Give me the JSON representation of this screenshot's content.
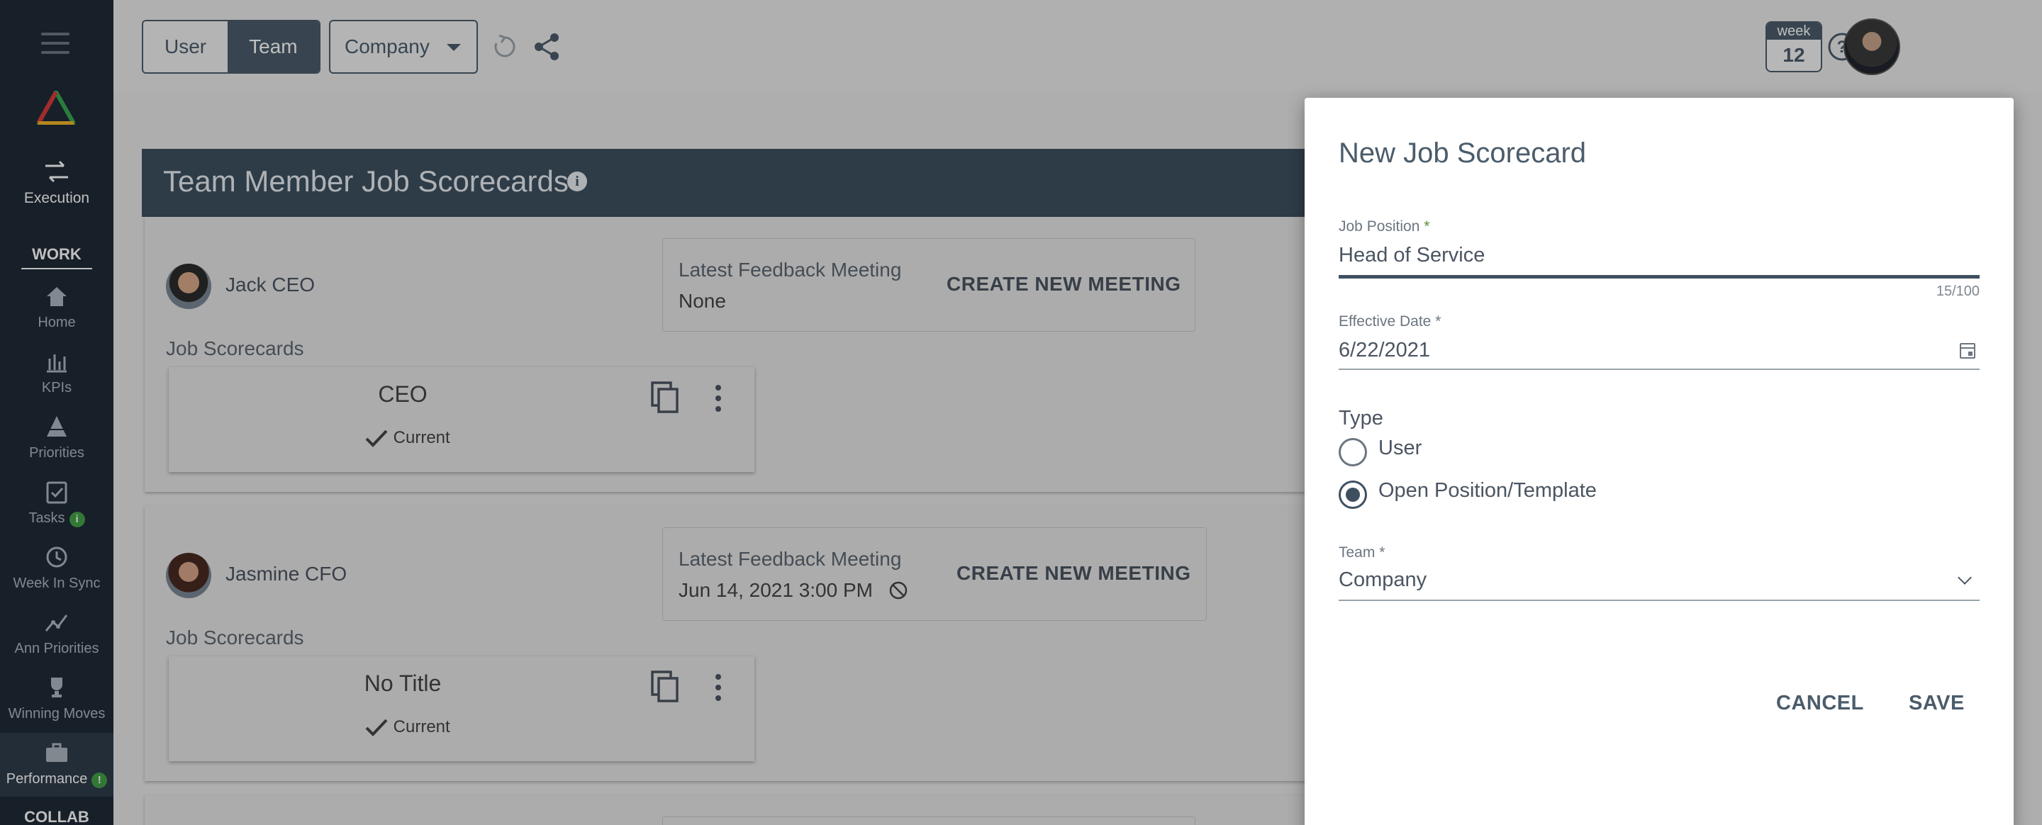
{
  "sidebar": {
    "execution_label": "Execution",
    "work_heading": "WORK",
    "items": [
      {
        "label": "Home",
        "icon": "home-icon"
      },
      {
        "label": "KPIs",
        "icon": "chart-bars-icon"
      },
      {
        "label": "Priorities",
        "icon": "priorities-icon"
      },
      {
        "label": "Tasks",
        "icon": "tasks-icon",
        "badge": "i"
      },
      {
        "label": "Week In Sync",
        "icon": "sync-icon"
      },
      {
        "label": "Ann Priorities",
        "icon": "trend-icon"
      },
      {
        "label": "Winning Moves",
        "icon": "trophy-icon"
      },
      {
        "label": "Performance",
        "icon": "briefcase-icon",
        "badge": "!"
      }
    ],
    "collab_heading": "COLLAB"
  },
  "topbar": {
    "toggle": {
      "user": "User",
      "team": "Team",
      "selected": "Team"
    },
    "team_select": "Company",
    "week_label": "week",
    "week_number": "12"
  },
  "panel": {
    "title": "Team Member Job Scorecards"
  },
  "members": [
    {
      "name": "Jack CEO",
      "feedback_label": "Latest Feedback Meeting",
      "feedback_value": "None",
      "create_button": "CREATE NEW MEETING",
      "job_scorecards_label": "Job Scorecards",
      "card_title": "CEO",
      "card_status": "Current"
    },
    {
      "name": "Jasmine CFO",
      "feedback_label": "Latest Feedback Meeting",
      "feedback_value": "Jun 14, 2021 3:00 PM",
      "create_button": "CREATE NEW MEETING",
      "job_scorecards_label": "Job Scorecards",
      "card_title": "No Title",
      "card_status": "Current"
    }
  ],
  "dialog": {
    "title": "New Job Scorecard",
    "job_position": {
      "label": "Job Position",
      "value": "Head of Service",
      "counter": "15/100"
    },
    "effective_date": {
      "label": "Effective Date",
      "value": "6/22/2021"
    },
    "type": {
      "label": "Type",
      "options": [
        "User",
        "Open Position/Template"
      ],
      "selected": "Open Position/Template"
    },
    "team": {
      "label": "Team",
      "value": "Company"
    },
    "required_mark": "*",
    "cancel_label": "CANCEL",
    "save_label": "SAVE"
  },
  "colors": {
    "sidebar": "#1f2a36",
    "header": "#3e5060",
    "accent": "#4b5c6b",
    "badge_green": "#43a047"
  }
}
